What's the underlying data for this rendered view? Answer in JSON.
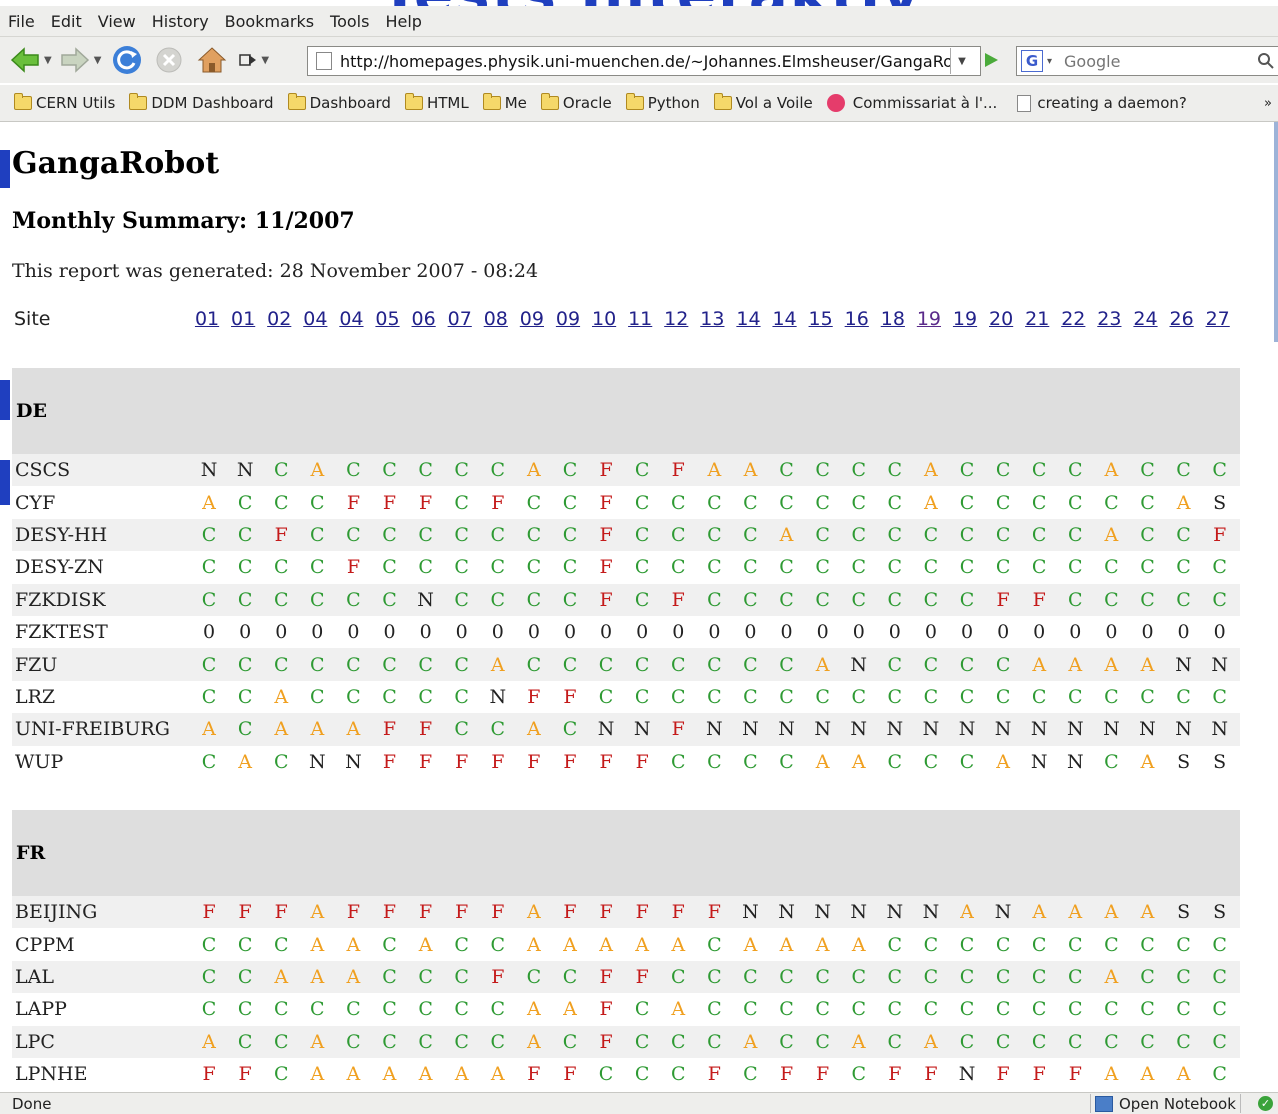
{
  "menu": [
    {
      "label": "File"
    },
    {
      "label": "Edit"
    },
    {
      "label": "View"
    },
    {
      "label": "History"
    },
    {
      "label": "Bookmarks"
    },
    {
      "label": "Tools"
    },
    {
      "label": "Help"
    }
  ],
  "address_bar": {
    "url": "http://homepages.physik.uni-muenchen.de/~Johannes.Elmsheuser/GangaRob"
  },
  "search": {
    "placeholder": "Google"
  },
  "bookmarks": [
    {
      "label": "CERN Utils",
      "icon": "folder-icon"
    },
    {
      "label": "DDM Dashboard",
      "icon": "folder-icon"
    },
    {
      "label": "Dashboard",
      "icon": "folder-icon"
    },
    {
      "label": "HTML",
      "icon": "folder-icon"
    },
    {
      "label": "Me",
      "icon": "folder-icon"
    },
    {
      "label": "Oracle",
      "icon": "folder-icon"
    },
    {
      "label": "Python",
      "icon": "folder-icon"
    },
    {
      "label": "Vol a Voile",
      "icon": "folder-icon"
    },
    {
      "label": "Commissariat à l'...",
      "icon": "site-icon"
    },
    {
      "label": "creating a daemon?",
      "icon": "page-icon"
    }
  ],
  "page": {
    "title": "GangaRobot",
    "subtitle": "Monthly Summary: 11/2007",
    "generated": "This report was generated: 28 November 2007 - 08:24",
    "site_header": "Site"
  },
  "days": [
    "01",
    "01",
    "02",
    "04",
    "04",
    "05",
    "06",
    "07",
    "08",
    "09",
    "09",
    "10",
    "11",
    "12",
    "13",
    "14",
    "14",
    "15",
    "16",
    "18",
    "19",
    "19",
    "20",
    "21",
    "22",
    "23",
    "24",
    "26",
    "27"
  ],
  "status_colors": {
    "C": "#2e9a33",
    "A": "#f0a020",
    "F": "#c41a1a",
    "N": "#222222",
    "S": "#222222",
    "0": "#222222"
  },
  "groups": [
    {
      "name": "DE",
      "sites": [
        {
          "name": "CSCS",
          "statuses": [
            "N",
            "N",
            "C",
            "A",
            "C",
            "C",
            "C",
            "C",
            "C",
            "A",
            "C",
            "F",
            "C",
            "F",
            "A",
            "A",
            "C",
            "C",
            "C",
            "C",
            "A",
            "C",
            "C",
            "C",
            "C",
            "A",
            "C",
            "C",
            "C"
          ]
        },
        {
          "name": "CYF",
          "statuses": [
            "A",
            "C",
            "C",
            "C",
            "F",
            "F",
            "F",
            "C",
            "F",
            "C",
            "C",
            "F",
            "C",
            "C",
            "C",
            "C",
            "C",
            "C",
            "C",
            "C",
            "A",
            "C",
            "C",
            "C",
            "C",
            "C",
            "C",
            "A",
            "S"
          ]
        },
        {
          "name": "DESY-HH",
          "statuses": [
            "C",
            "C",
            "F",
            "C",
            "C",
            "C",
            "C",
            "C",
            "C",
            "C",
            "C",
            "F",
            "C",
            "C",
            "C",
            "C",
            "A",
            "C",
            "C",
            "C",
            "C",
            "C",
            "C",
            "C",
            "C",
            "A",
            "C",
            "C",
            "F"
          ]
        },
        {
          "name": "DESY-ZN",
          "statuses": [
            "C",
            "C",
            "C",
            "C",
            "F",
            "C",
            "C",
            "C",
            "C",
            "C",
            "C",
            "F",
            "C",
            "C",
            "C",
            "C",
            "C",
            "C",
            "C",
            "C",
            "C",
            "C",
            "C",
            "C",
            "C",
            "C",
            "C",
            "C",
            "C"
          ]
        },
        {
          "name": "FZKDISK",
          "statuses": [
            "C",
            "C",
            "C",
            "C",
            "C",
            "C",
            "N",
            "C",
            "C",
            "C",
            "C",
            "F",
            "C",
            "F",
            "C",
            "C",
            "C",
            "C",
            "C",
            "C",
            "C",
            "C",
            "F",
            "F",
            "C",
            "C",
            "C",
            "C",
            "C"
          ]
        },
        {
          "name": "FZKTEST",
          "statuses": [
            "0",
            "0",
            "0",
            "0",
            "0",
            "0",
            "0",
            "0",
            "0",
            "0",
            "0",
            "0",
            "0",
            "0",
            "0",
            "0",
            "0",
            "0",
            "0",
            "0",
            "0",
            "0",
            "0",
            "0",
            "0",
            "0",
            "0",
            "0",
            "0"
          ]
        },
        {
          "name": "FZU",
          "statuses": [
            "C",
            "C",
            "C",
            "C",
            "C",
            "C",
            "C",
            "C",
            "A",
            "C",
            "C",
            "C",
            "C",
            "C",
            "C",
            "C",
            "C",
            "A",
            "N",
            "C",
            "C",
            "C",
            "C",
            "A",
            "A",
            "A",
            "A",
            "N",
            "N"
          ]
        },
        {
          "name": "LRZ",
          "statuses": [
            "C",
            "C",
            "A",
            "C",
            "C",
            "C",
            "C",
            "C",
            "N",
            "F",
            "F",
            "C",
            "C",
            "C",
            "C",
            "C",
            "C",
            "C",
            "C",
            "C",
            "C",
            "C",
            "C",
            "C",
            "C",
            "C",
            "C",
            "C",
            "C"
          ]
        },
        {
          "name": "UNI-FREIBURG",
          "statuses": [
            "A",
            "C",
            "A",
            "A",
            "A",
            "F",
            "F",
            "C",
            "C",
            "A",
            "C",
            "N",
            "N",
            "F",
            "N",
            "N",
            "N",
            "N",
            "N",
            "N",
            "N",
            "N",
            "N",
            "N",
            "N",
            "N",
            "N",
            "N",
            "N"
          ]
        },
        {
          "name": "WUP",
          "statuses": [
            "C",
            "A",
            "C",
            "N",
            "N",
            "F",
            "F",
            "F",
            "F",
            "F",
            "F",
            "F",
            "F",
            "C",
            "C",
            "C",
            "C",
            "A",
            "A",
            "C",
            "C",
            "C",
            "A",
            "N",
            "N",
            "C",
            "A",
            "S",
            "S"
          ]
        }
      ]
    },
    {
      "name": "FR",
      "sites": [
        {
          "name": "BEIJING",
          "statuses": [
            "F",
            "F",
            "F",
            "A",
            "F",
            "F",
            "F",
            "F",
            "F",
            "A",
            "F",
            "F",
            "F",
            "F",
            "F",
            "N",
            "N",
            "N",
            "N",
            "N",
            "N",
            "A",
            "N",
            "A",
            "A",
            "A",
            "A",
            "S",
            "S"
          ]
        },
        {
          "name": "CPPM",
          "statuses": [
            "C",
            "C",
            "C",
            "A",
            "A",
            "C",
            "A",
            "C",
            "C",
            "A",
            "A",
            "A",
            "A",
            "A",
            "C",
            "A",
            "A",
            "A",
            "A",
            "C",
            "C",
            "C",
            "C",
            "C",
            "C",
            "C",
            "C",
            "C",
            "C"
          ]
        },
        {
          "name": "LAL",
          "statuses": [
            "C",
            "C",
            "A",
            "A",
            "A",
            "C",
            "C",
            "C",
            "F",
            "C",
            "C",
            "F",
            "F",
            "C",
            "C",
            "C",
            "C",
            "C",
            "C",
            "C",
            "C",
            "C",
            "C",
            "C",
            "C",
            "A",
            "C",
            "C",
            "C"
          ]
        },
        {
          "name": "LAPP",
          "statuses": [
            "C",
            "C",
            "C",
            "C",
            "C",
            "C",
            "C",
            "C",
            "C",
            "A",
            "A",
            "F",
            "C",
            "A",
            "C",
            "C",
            "C",
            "C",
            "C",
            "C",
            "C",
            "C",
            "C",
            "C",
            "C",
            "C",
            "C",
            "C",
            "C"
          ]
        },
        {
          "name": "LPC",
          "statuses": [
            "A",
            "C",
            "C",
            "A",
            "C",
            "C",
            "C",
            "C",
            "C",
            "A",
            "C",
            "F",
            "C",
            "C",
            "C",
            "A",
            "C",
            "C",
            "A",
            "C",
            "A",
            "C",
            "C",
            "C",
            "C",
            "C",
            "C",
            "C",
            "C"
          ]
        },
        {
          "name": "LPNHE",
          "statuses": [
            "F",
            "F",
            "C",
            "A",
            "A",
            "A",
            "A",
            "A",
            "A",
            "F",
            "F",
            "C",
            "C",
            "C",
            "F",
            "C",
            "F",
            "F",
            "C",
            "F",
            "F",
            "N",
            "F",
            "F",
            "F",
            "A",
            "A",
            "A",
            "C"
          ]
        }
      ]
    }
  ],
  "statusbar": {
    "text": "Done",
    "notebook": "Open Notebook"
  }
}
